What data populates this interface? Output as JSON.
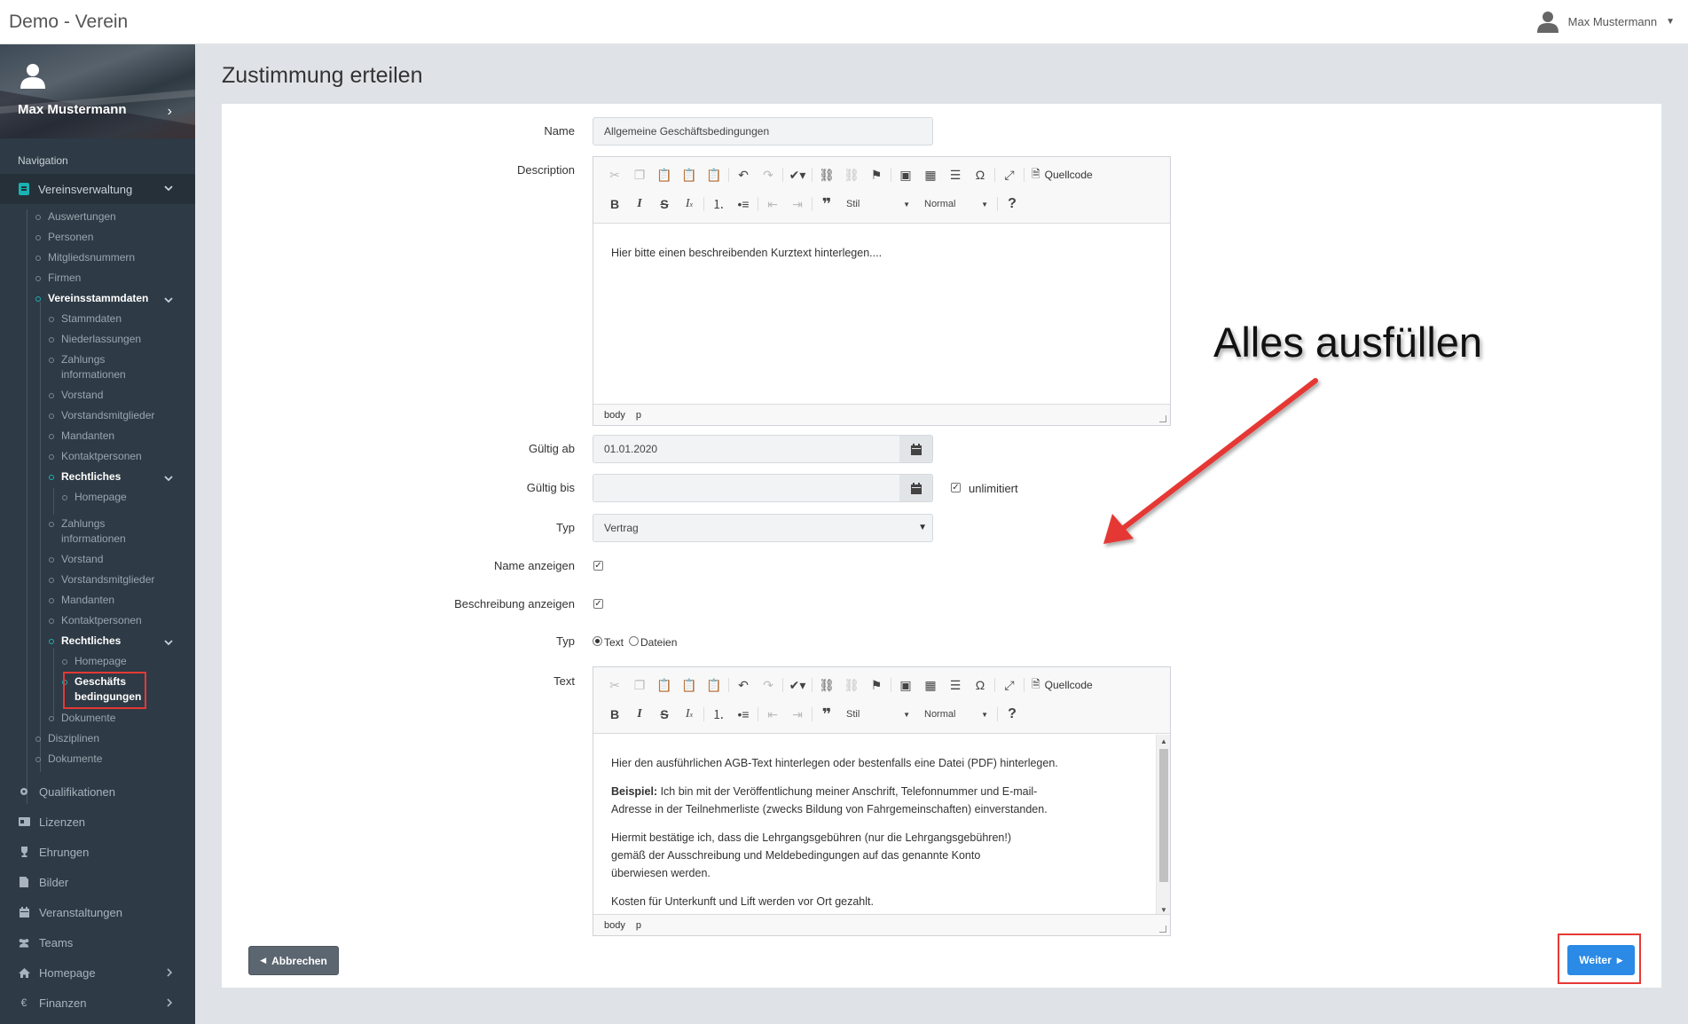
{
  "app": {
    "title": "Demo - Verein"
  },
  "user": {
    "name": "Max Mustermann"
  },
  "sidebar": {
    "profile_name": "Max Mustermann",
    "nav_label": "Navigation",
    "group": "Vereinsverwaltung",
    "tree": {
      "auswertungen": "Auswertungen",
      "personen": "Personen",
      "mitgliedsnummern": "Mitgliedsnummern",
      "firmen": "Firmen",
      "vereinsstammdaten": "Vereinsstammdaten",
      "stammdaten": "Stammdaten",
      "niederlassungen": "Niederlassungen",
      "zahlungs1_a": "Zahlungs",
      "zahlungs1_b": "informationen",
      "vorstand1": "Vorstand",
      "vorstandsmitglieder1": "Vorstandsmitglieder",
      "mandanten1": "Mandanten",
      "kontaktpersonen1": "Kontaktpersonen",
      "rechtliches1": "Rechtliches",
      "homepage1": "Homepage",
      "zahlungs2_a": "Zahlungs",
      "zahlungs2_b": "informationen",
      "vorstand2": "Vorstand",
      "vorstandsmitglieder2": "Vorstandsmitglieder",
      "mandanten2": "Mandanten",
      "kontaktpersonen2": "Kontaktpersonen",
      "rechtliches2": "Rechtliches",
      "homepage2": "Homepage",
      "geschaefts_a": "Geschäfts",
      "geschaefts_b": "bedingungen",
      "dokumente_inner": "Dokumente",
      "disziplinen": "Disziplinen",
      "dokumente": "Dokumente"
    },
    "items": {
      "qualifikationen": "Qualifikationen",
      "lizenzen": "Lizenzen",
      "ehrungen": "Ehrungen",
      "bilder": "Bilder",
      "veranstaltungen": "Veranstaltungen",
      "teams": "Teams",
      "homepage": "Homepage",
      "finanzen": "Finanzen"
    }
  },
  "page": {
    "title": "Zustimmung erteilen"
  },
  "form": {
    "name_label": "Name",
    "name_value": "Allgemeine Geschäftsbedingungen",
    "description_label": "Description",
    "description_text": "Hier bitte einen beschreibenden Kurztext hinterlegen....",
    "gueltig_ab_label": "Gültig ab",
    "gueltig_ab_value": "01.01.2020",
    "gueltig_bis_label": "Gültig bis",
    "gueltig_bis_value": "",
    "unlimitiert_label": "unlimitiert",
    "typ_label": "Typ",
    "typ_value": "Vertrag",
    "name_anzeigen_label": "Name anzeigen",
    "beschreibung_anzeigen_label": "Beschreibung anzeigen",
    "typ2_label": "Typ",
    "radio_text": "Text",
    "radio_dateien": "Dateien",
    "text_label": "Text",
    "text_p1": "Hier den ausführlichen AGB-Text hinterlegen oder bestenfalls eine Datei (PDF) hinterlegen.",
    "text_p2_bold": "Beispiel:",
    "text_p2_line1": " Ich bin mit der Veröffentlichung meiner Anschrift, Telefonnummer und E-mail-",
    "text_p2_line2": "Adresse in der Teilnehmerliste (zwecks Bildung von Fahrgemeinschaften) einverstanden.",
    "text_p3_line1": "Hiermit bestätige ich, dass die Lehrgangsgebühren (nur die Lehrgangsgebühren!)",
    "text_p3_line2": "gemäß der Ausschreibung und Meldebedingungen auf das genannte Konto",
    "text_p3_line3": "überwiesen werden.",
    "text_p4": "Kosten für Unterkunft und Lift werden vor Ort gezahlt."
  },
  "editor": {
    "source_label": "Quellcode",
    "style_label": "Stil",
    "format_label": "Normal",
    "path_body": "body",
    "path_p": "p"
  },
  "buttons": {
    "cancel": "Abbrechen",
    "next": "Weiter"
  },
  "annotation": {
    "text": "Alles ausfüllen",
    "color": "#e53935"
  },
  "colors": {
    "accent": "#19b3b3",
    "primary": "#2a8ae5",
    "sidebar": "#2e3a45"
  }
}
